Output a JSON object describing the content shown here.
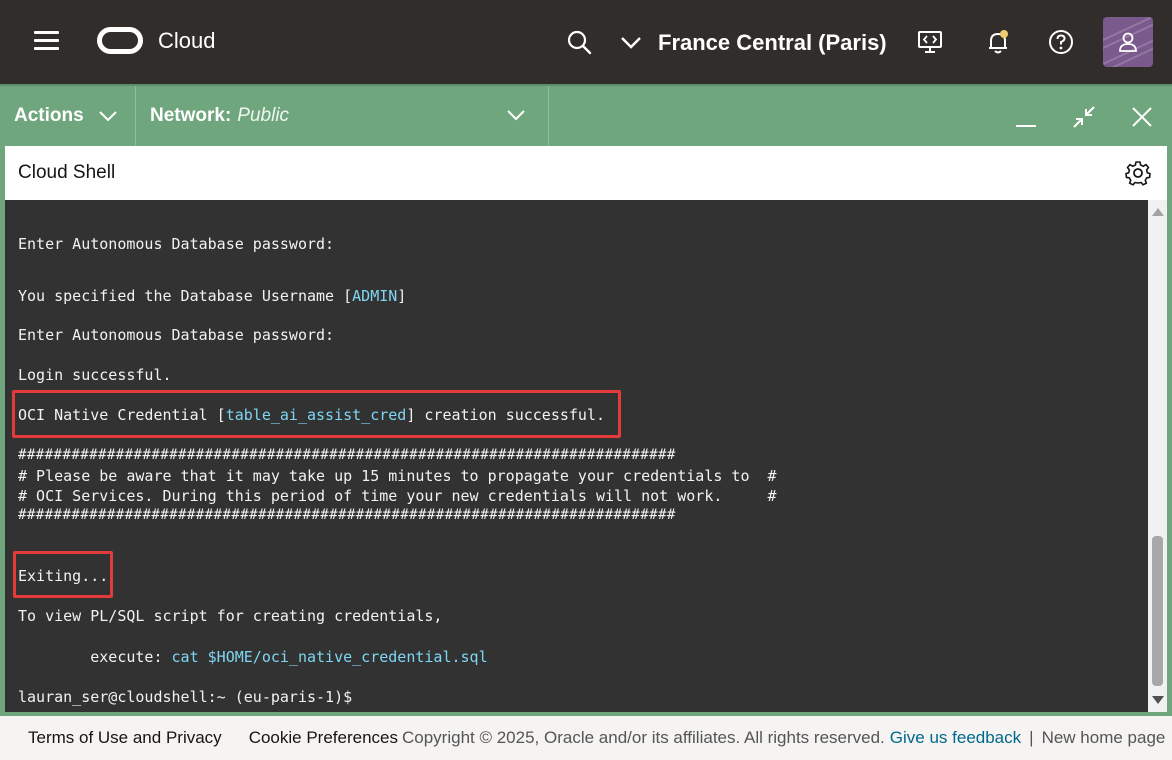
{
  "header": {
    "brand": "Cloud",
    "region": "France Central (Paris)"
  },
  "shellbar": {
    "actions_label": "Actions",
    "network_label": "Network:",
    "network_value": "Public"
  },
  "shell": {
    "title": "Cloud Shell",
    "lines": {
      "l1": "Enter Autonomous Database password:",
      "l2_pre": "You specified the Database Username [",
      "l2_user": "ADMIN",
      "l2_post": "]",
      "l3": "Enter Autonomous Database password:",
      "l4": "Login successful.",
      "l5_pre": "OCI Native Credential [",
      "l5_cred": "table_ai_assist_cred",
      "l5_post": "] creation successful.",
      "l6": "##########################################################################",
      "l7": "# Please be aware that it may take up 15 minutes to propagate your credentials to  #",
      "l8": "# OCI Services. During this period of time your new credentials will not work.     #",
      "l9": "##########################################################################",
      "l10": "Exiting...",
      "l11": "To view PL/SQL script for creating credentials,",
      "l12_pre": "        execute: ",
      "l12_cmd": "cat $HOME/oci_native_credential.sql",
      "l13": "lauran_ser@cloudshell:~ (eu-paris-1)$"
    }
  },
  "footer": {
    "terms": "Terms of Use and Privacy",
    "cookies": "Cookie Preferences",
    "copyright": "Copyright © 2025, Oracle and/or its affiliates. All rights reserved.",
    "feedback": "Give us feedback",
    "separator": "|",
    "new_home": "New home page"
  },
  "colors": {
    "header_bg": "#312d2a",
    "shellbar_bg": "#6fa67e",
    "terminal_bg": "#323232",
    "highlight": "#e33b3b",
    "link": "#00688c"
  }
}
